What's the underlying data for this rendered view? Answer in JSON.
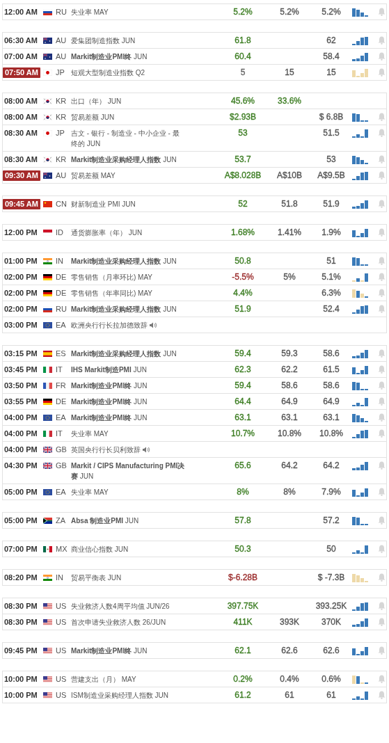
{
  "groups": [
    {
      "rows": [
        {
          "time": "12:00 AM",
          "live": false,
          "flag": {
            "kind": "ru"
          },
          "code": "RU",
          "event": "失业率 MAY",
          "speech": false,
          "actual": {
            "text": "5.2%",
            "color": "#3c7d22"
          },
          "forecast": {
            "text": "5.2%"
          },
          "previous": "5.2%",
          "sparkline": {
            "kind": "positive"
          }
        }
      ]
    },
    {
      "rows": [
        {
          "time": "06:30 AM",
          "live": false,
          "flag": {
            "kind": "au"
          },
          "code": "AU",
          "event": "爱集团制造指数 JUN",
          "speech": false,
          "actual": {
            "text": "61.8",
            "color": "#3c7d22"
          },
          "previous": "62",
          "sparkline": {
            "kind": "positive"
          }
        },
        {
          "time": "07:00 AM",
          "live": false,
          "flag": {
            "kind": "au"
          },
          "code": "AU",
          "event": "**Markit制造业PMI终** JUN",
          "speech": false,
          "actual": {
            "text": "60.4",
            "color": "#3c7d22"
          },
          "previous": "58.4",
          "sparkline": {
            "kind": "positive"
          }
        },
        {
          "time": "07:50 AM",
          "live": true,
          "flag": {
            "kind": "jp"
          },
          "code": "JP",
          "event": "短观大型制造业指数 Q2",
          "speech": false,
          "actual": {
            "text": "5",
            "color": "#666666"
          },
          "forecast": {
            "text": "15"
          },
          "previous": "15",
          "sparkline": {
            "kind": "negative"
          }
        }
      ]
    },
    {
      "rows": [
        {
          "time": "08:00 AM",
          "live": false,
          "flag": {
            "kind": "kr"
          },
          "code": "KR",
          "event": "出口（年） JUN",
          "speech": false,
          "actual": {
            "text": "45.6%",
            "color": "#3c7d22"
          },
          "forecast": {
            "text": "33.6%",
            "color": "#3c7d22"
          }
        },
        {
          "time": "08:00 AM",
          "live": false,
          "flag": {
            "kind": "kr"
          },
          "code": "KR",
          "event": "贸易差额 JUN",
          "speech": false,
          "actual": {
            "text": "$2.93B",
            "color": "#3c7d22"
          },
          "previous": "$ 6.8B",
          "sparkline": {
            "kind": "positive"
          }
        },
        {
          "time": "08:30 AM",
          "live": false,
          "flag": {
            "kind": "jp"
          },
          "code": "JP",
          "event": "吉文 - 银行 - 制造业 - 中小企业 - 最终的 JUN",
          "speech": false,
          "actual": {
            "text": "53",
            "color": "#3c7d22"
          },
          "previous": "51.5",
          "sparkline": {
            "kind": "positive"
          }
        },
        {
          "time": "08:30 AM",
          "live": false,
          "flag": {
            "kind": "kr"
          },
          "code": "KR",
          "event": "**Markit制造业采购经理人指数** JUN",
          "speech": false,
          "actual": {
            "text": "53.7",
            "color": "#3c7d22"
          },
          "previous": "53",
          "sparkline": {
            "kind": "positive"
          }
        },
        {
          "time": "09:30 AM",
          "live": true,
          "flag": {
            "kind": "au"
          },
          "code": "AU",
          "event": "贸易差额 MAY",
          "speech": false,
          "actual": {
            "text": "A$8.028B",
            "color": "#3c7d22"
          },
          "forecast": {
            "text": "A$10B"
          },
          "previous": "A$9.5B",
          "sparkline": {
            "kind": "positive"
          }
        }
      ]
    },
    {
      "rows": [
        {
          "time": "09:45 AM",
          "live": true,
          "flag": {
            "kind": "cn"
          },
          "code": "CN",
          "event": "财新制造业 PMI JUN",
          "speech": false,
          "actual": {
            "text": "52",
            "color": "#3c7d22"
          },
          "forecast": {
            "text": "51.8"
          },
          "previous": "51.9",
          "sparkline": {
            "kind": "positive"
          }
        }
      ]
    },
    {
      "rows": [
        {
          "time": "12:00 PM",
          "live": false,
          "flag": {
            "kind": "id"
          },
          "code": "ID",
          "event": "通货膨胀率（年） JUN",
          "speech": false,
          "actual": {
            "text": "1.68%",
            "color": "#3c7d22"
          },
          "forecast": {
            "text": "1.41%"
          },
          "previous": "1.9%",
          "sparkline": {
            "kind": "positive"
          }
        }
      ]
    },
    {
      "rows": [
        {
          "time": "01:00 PM",
          "live": false,
          "flag": {
            "kind": "in"
          },
          "code": "IN",
          "event": "**Markit制造业采购经理人指数** JUN",
          "speech": false,
          "actual": {
            "text": "50.8",
            "color": "#3c7d22"
          },
          "previous": "51",
          "sparkline": {
            "kind": "positive"
          }
        },
        {
          "time": "02:00 PM",
          "live": false,
          "flag": {
            "kind": "de"
          },
          "code": "DE",
          "event": "零售销售（月率环比) MAY",
          "speech": false,
          "actual": {
            "text": "-5.5%",
            "color": "#9b2c2c"
          },
          "forecast": {
            "text": "5%"
          },
          "previous": "5.1%",
          "sparkline": {
            "kind": "mixed"
          }
        },
        {
          "time": "02:00 PM",
          "live": false,
          "flag": {
            "kind": "de"
          },
          "code": "DE",
          "event": "零售销售（年率同比) MAY",
          "speech": false,
          "actual": {
            "text": "4.4%",
            "color": "#3c7d22"
          },
          "previous": "6.3%",
          "sparkline": {
            "kind": "mixed"
          }
        },
        {
          "time": "02:00 PM",
          "live": false,
          "flag": {
            "kind": "ru"
          },
          "code": "RU",
          "event": "**Markit制造业采购经理人指数** JUN",
          "speech": false,
          "actual": {
            "text": "51.9",
            "color": "#3c7d22"
          },
          "previous": "52.4",
          "sparkline": {
            "kind": "positive"
          }
        },
        {
          "time": "03:00 PM",
          "live": false,
          "flag": {
            "kind": "eu"
          },
          "code": "EA",
          "event": "欧洲央行行长拉加德致辞",
          "speech": true
        }
      ]
    },
    {
      "rows": [
        {
          "time": "03:15 PM",
          "live": false,
          "flag": {
            "kind": "es"
          },
          "code": "ES",
          "event": "**Markit制造业采购经理人指数** JUN",
          "speech": false,
          "actual": {
            "text": "59.4",
            "color": "#3c7d22"
          },
          "forecast": {
            "text": "59.3"
          },
          "previous": "58.6",
          "sparkline": {
            "kind": "positive"
          }
        },
        {
          "time": "03:45 PM",
          "live": false,
          "flag": {
            "kind": "it"
          },
          "code": "IT",
          "event": "**IHS Markit制造PMI** JUN",
          "speech": false,
          "actual": {
            "text": "62.3",
            "color": "#3c7d22"
          },
          "forecast": {
            "text": "62.2"
          },
          "previous": "61.5",
          "sparkline": {
            "kind": "positive"
          }
        },
        {
          "time": "03:50 PM",
          "live": false,
          "flag": {
            "kind": "fr"
          },
          "code": "FR",
          "event": "**Markit制造业PMI终** JUN",
          "speech": false,
          "actual": {
            "text": "59.4",
            "color": "#3c7d22"
          },
          "forecast": {
            "text": "58.6"
          },
          "previous": "58.6",
          "sparkline": {
            "kind": "positive"
          }
        },
        {
          "time": "03:55 PM",
          "live": false,
          "flag": {
            "kind": "de"
          },
          "code": "DE",
          "event": "**Markit制造业PMI终** JUN",
          "speech": false,
          "actual": {
            "text": "64.4",
            "color": "#3c7d22"
          },
          "forecast": {
            "text": "64.9"
          },
          "previous": "64.9",
          "sparkline": {
            "kind": "positive"
          }
        },
        {
          "time": "04:00 PM",
          "live": false,
          "flag": {
            "kind": "eu"
          },
          "code": "EA",
          "event": "**Markit制造业PMI终** JUN",
          "speech": false,
          "actual": {
            "text": "63.1",
            "color": "#3c7d22"
          },
          "forecast": {
            "text": "63.1"
          },
          "previous": "63.1",
          "sparkline": {
            "kind": "positive"
          }
        },
        {
          "time": "04:00 PM",
          "live": false,
          "flag": {
            "kind": "it"
          },
          "code": "IT",
          "event": "失业率 MAY",
          "speech": false,
          "actual": {
            "text": "10.7%",
            "color": "#3c7d22"
          },
          "forecast": {
            "text": "10.8%"
          },
          "previous": "10.8%",
          "sparkline": {
            "kind": "positive"
          }
        },
        {
          "time": "04:00 PM",
          "live": false,
          "flag": {
            "kind": "gb"
          },
          "code": "GB",
          "event": "英国央行行长贝利致辞",
          "speech": true
        },
        {
          "time": "04:30 PM",
          "live": false,
          "flag": {
            "kind": "gb"
          },
          "code": "GB",
          "event": "**Markit / CIPS Manufacturing PMI决赛** JUN",
          "speech": false,
          "actual": {
            "text": "65.6",
            "color": "#3c7d22"
          },
          "forecast": {
            "text": "64.2"
          },
          "previous": "64.2",
          "sparkline": {
            "kind": "positive"
          }
        },
        {
          "time": "05:00 PM",
          "live": false,
          "flag": {
            "kind": "eu"
          },
          "code": "EA",
          "event": "失业率 MAY",
          "speech": false,
          "actual": {
            "text": "8%",
            "color": "#3c7d22"
          },
          "forecast": {
            "text": "8%"
          },
          "previous": "7.9%",
          "sparkline": {
            "kind": "positive"
          }
        }
      ]
    },
    {
      "rows": [
        {
          "time": "05:00 PM",
          "live": false,
          "flag": {
            "kind": "za"
          },
          "code": "ZA",
          "event": "**Absa 制造业PMI** JUN",
          "speech": false,
          "actual": {
            "text": "57.8",
            "color": "#3c7d22"
          },
          "previous": "57.2",
          "sparkline": {
            "kind": "positive"
          }
        }
      ]
    },
    {
      "rows": [
        {
          "time": "07:00 PM",
          "live": false,
          "flag": {
            "kind": "mx"
          },
          "code": "MX",
          "event": "商业信心指数 JUN",
          "speech": false,
          "actual": {
            "text": "50.3",
            "color": "#3c7d22"
          },
          "previous": "50",
          "sparkline": {
            "kind": "positive"
          }
        }
      ]
    },
    {
      "rows": [
        {
          "time": "08:20 PM",
          "live": false,
          "flag": {
            "kind": "in"
          },
          "code": "IN",
          "event": "贸易平衡表 JUN",
          "speech": false,
          "actual": {
            "text": "$-6.28B",
            "color": "#9b2c2c"
          },
          "previous": "$ -7.3B",
          "sparkline": {
            "kind": "negative"
          }
        }
      ]
    },
    {
      "rows": [
        {
          "time": "08:30 PM",
          "live": false,
          "flag": {
            "kind": "us"
          },
          "code": "US",
          "event": "失业救济人数4周平均值 JUN/26",
          "speech": false,
          "actual": {
            "text": "397.75K",
            "color": "#3c7d22"
          },
          "previous": "393.25K",
          "sparkline": {
            "kind": "positive"
          }
        },
        {
          "time": "08:30 PM",
          "live": false,
          "flag": {
            "kind": "us"
          },
          "code": "US",
          "event": "首次申请失业救济人数 26/JUN",
          "speech": false,
          "actual": {
            "text": "411K",
            "color": "#3c7d22"
          },
          "forecast": {
            "text": "393K"
          },
          "previous": "370K",
          "sparkline": {
            "kind": "positive"
          }
        }
      ]
    },
    {
      "rows": [
        {
          "time": "09:45 PM",
          "live": false,
          "flag": {
            "kind": "us"
          },
          "code": "US",
          "event": "**Markit制造业PMI终** JUN",
          "speech": false,
          "actual": {
            "text": "62.1",
            "color": "#3c7d22"
          },
          "forecast": {
            "text": "62.6"
          },
          "previous": "62.6",
          "sparkline": {
            "kind": "positive"
          }
        }
      ]
    },
    {
      "rows": [
        {
          "time": "10:00 PM",
          "live": false,
          "flag": {
            "kind": "us"
          },
          "code": "US",
          "event": "营建支出（月） MAY",
          "speech": false,
          "actual": {
            "text": "0.2%",
            "color": "#3c7d22"
          },
          "forecast": {
            "text": "0.4%"
          },
          "previous": "0.6%",
          "sparkline": {
            "kind": "mixed"
          }
        },
        {
          "time": "10:00 PM",
          "live": false,
          "flag": {
            "kind": "us"
          },
          "code": "US",
          "event": "ISM制造业采购经理人指数 JUN",
          "speech": false,
          "actual": {
            "text": "61.2",
            "color": "#3c7d22"
          },
          "forecast": {
            "text": "61"
          },
          "previous": "61",
          "sparkline": {
            "kind": "positive"
          }
        }
      ]
    }
  ]
}
